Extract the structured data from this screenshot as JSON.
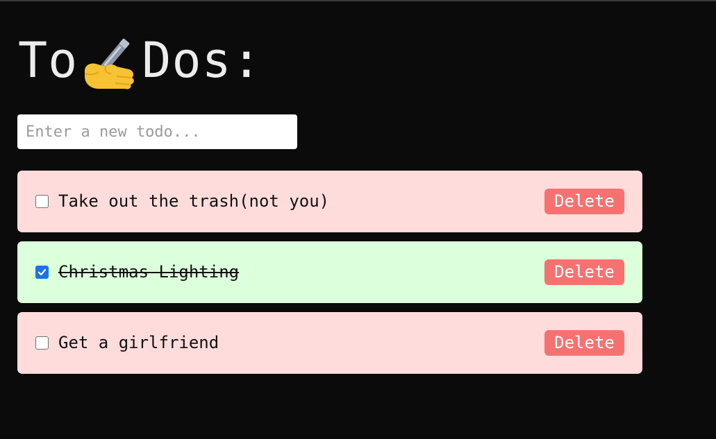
{
  "title": {
    "prefix": "To",
    "icon": "writing-hand-icon",
    "suffix": "Dos:"
  },
  "new_todo": {
    "value": "",
    "placeholder": "Enter a new todo..."
  },
  "colors": {
    "background": "#0b0b0b",
    "pending_item": "#ffdcdc",
    "done_item": "#dcffdc",
    "delete_button": "#f87171",
    "checkbox_checked": "#1a73e8"
  },
  "todos": [
    {
      "text": "Take out the trash(not you)",
      "completed": false,
      "delete_label": "Delete"
    },
    {
      "text": "Christmas Lighting",
      "completed": true,
      "delete_label": "Delete"
    },
    {
      "text": "Get a girlfriend",
      "completed": false,
      "delete_label": "Delete"
    }
  ]
}
